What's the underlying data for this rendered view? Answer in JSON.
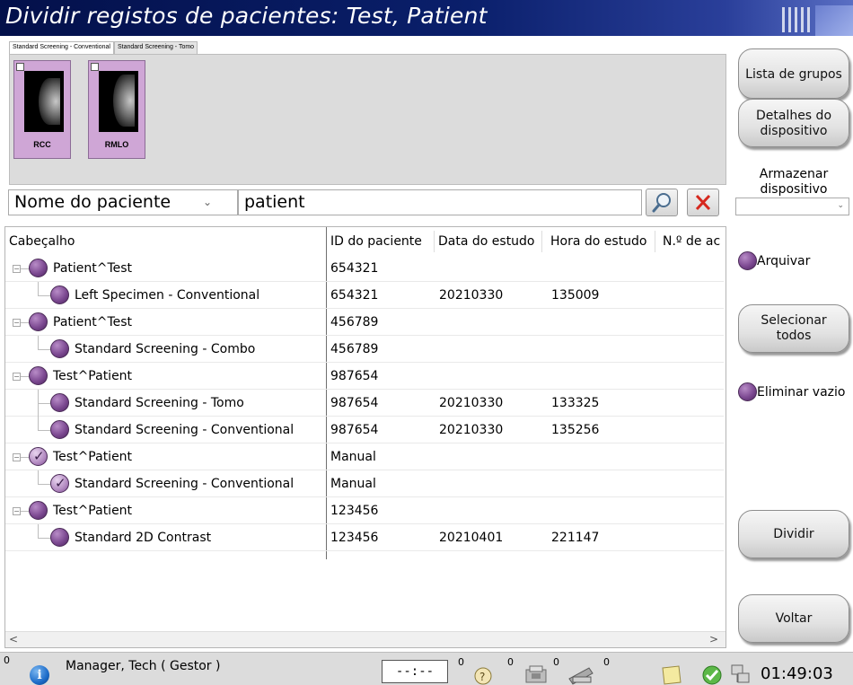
{
  "window": {
    "title": "Dividir registos de pacientes: Test, Patient"
  },
  "tabs": [
    {
      "label": "Standard Screening - Conventional",
      "active": true
    },
    {
      "label": "Standard Screening - Tomo",
      "active": false
    }
  ],
  "thumbnails": [
    {
      "label": "RCC"
    },
    {
      "label": "RMLO"
    }
  ],
  "search": {
    "type": "Nome do paciente",
    "query": "patient"
  },
  "table": {
    "columns": [
      "Cabeçalho",
      "ID do paciente",
      "Data do estudo",
      "Hora do estudo",
      "N.º de ac"
    ],
    "rows": [
      {
        "level": 0,
        "name": "Patient^Test",
        "patient_id": "654321",
        "study_date": "",
        "study_time": "",
        "checked": false
      },
      {
        "level": 1,
        "name": "Left Specimen - Conventional",
        "patient_id": "654321",
        "study_date": "20210330",
        "study_time": "135009",
        "checked": false
      },
      {
        "level": 0,
        "name": "Patient^Test",
        "patient_id": "456789",
        "study_date": "",
        "study_time": "",
        "checked": false
      },
      {
        "level": 1,
        "name": "Standard Screening - Combo",
        "patient_id": "456789",
        "study_date": "",
        "study_time": "",
        "checked": false
      },
      {
        "level": 0,
        "name": "Test^Patient",
        "patient_id": "987654",
        "study_date": "",
        "study_time": "",
        "checked": false
      },
      {
        "level": 1,
        "name": "Standard Screening - Tomo",
        "patient_id": "987654",
        "study_date": "20210330",
        "study_time": "133325",
        "checked": false
      },
      {
        "level": 1,
        "name": "Standard Screening - Conventional",
        "patient_id": "987654",
        "study_date": "20210330",
        "study_time": "135256",
        "checked": false
      },
      {
        "level": 0,
        "name": "Test^Patient",
        "patient_id": "Manual",
        "study_date": "",
        "study_time": "",
        "checked": true
      },
      {
        "level": 1,
        "name": "Standard Screening - Conventional",
        "patient_id": "Manual",
        "study_date": "",
        "study_time": "",
        "checked": true
      },
      {
        "level": 0,
        "name": "Test^Patient",
        "patient_id": "123456",
        "study_date": "",
        "study_time": "",
        "checked": false
      },
      {
        "level": 1,
        "name": "Standard 2D Contrast",
        "patient_id": "123456",
        "study_date": "20210401",
        "study_time": "221147",
        "checked": false
      }
    ]
  },
  "right_panel": {
    "group_list": "Lista de grupos",
    "device_details": "Detalhes do dispositivo",
    "storage_device": "Armazenar dispositivo",
    "archive": "Arquivar",
    "select_all": "Selecionar todos",
    "delete_empty": "Eliminar vazio",
    "split": "Dividir",
    "back": "Voltar"
  },
  "statusbar": {
    "count_left": "0",
    "user": "Manager, Tech ( Gestor )",
    "clock_placeholder": "--:--",
    "count_1": "0",
    "count_2": "0",
    "count_3": "0",
    "count_4": "0",
    "time": "01:49:03"
  },
  "colors": {
    "title_bar": "#0a1f6b",
    "orb_purple": "#7d4a92",
    "thumb_bg": "#cfa6d6",
    "clear_red": "#d6281e"
  }
}
